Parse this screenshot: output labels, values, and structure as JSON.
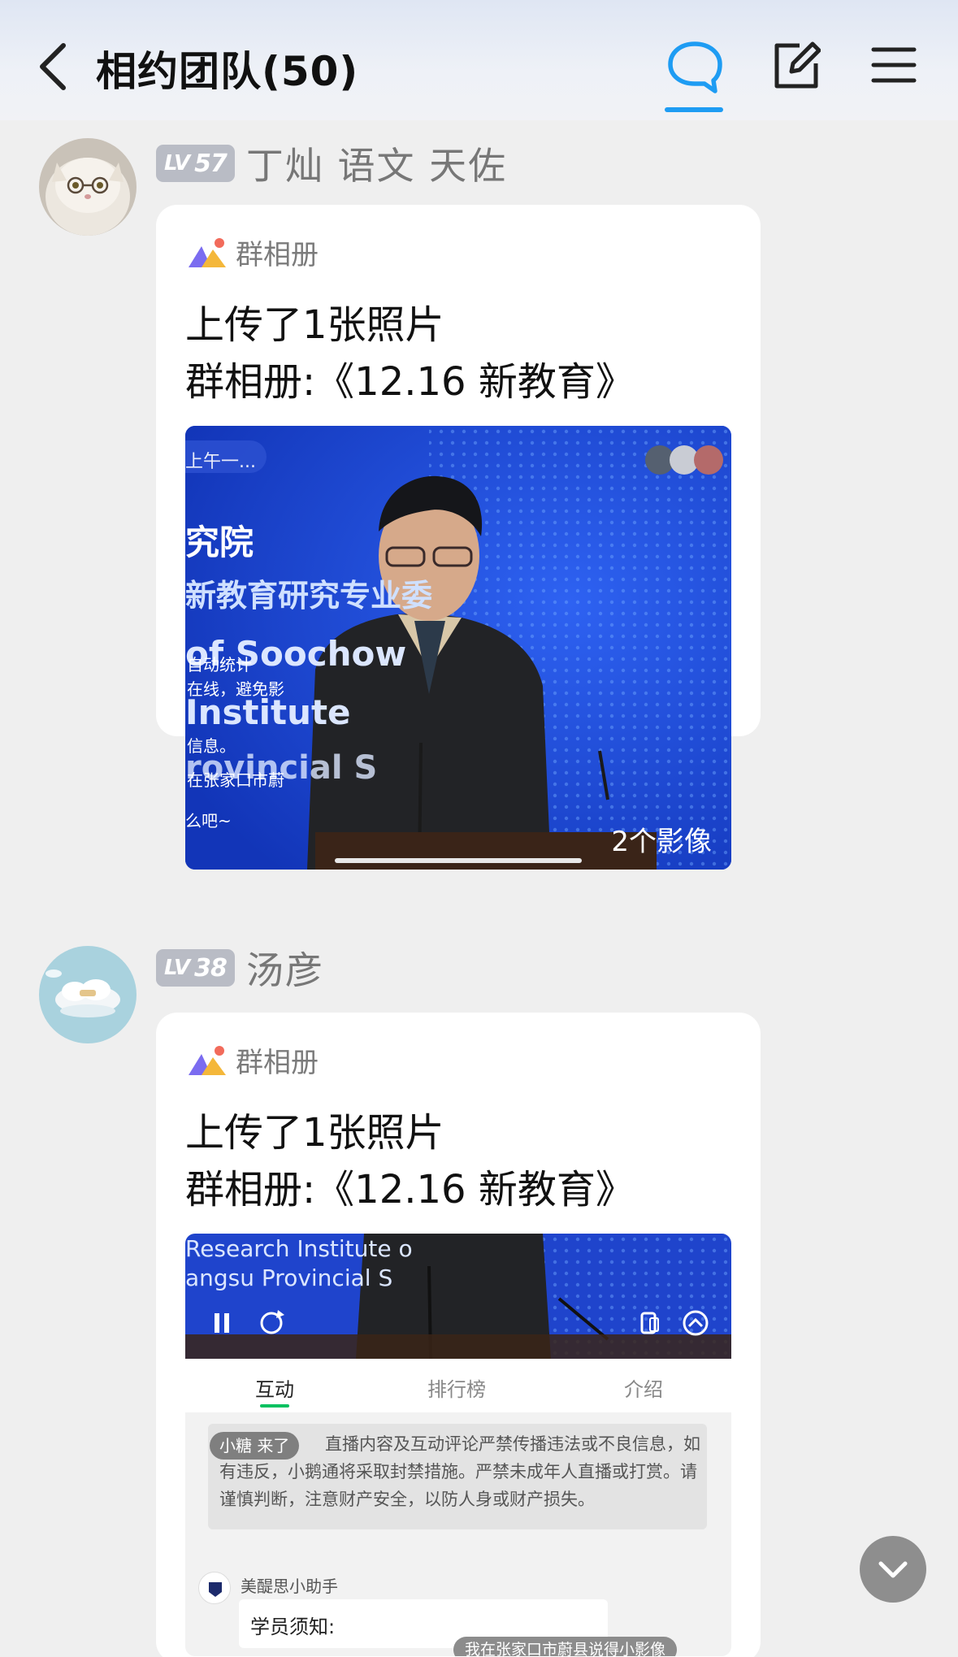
{
  "header": {
    "title": "相约团队(50)",
    "accent_color": "#1e9cf3",
    "icons": [
      "back-arrow-icon",
      "chat-bubble-icon",
      "edit-icon",
      "menu-icon"
    ]
  },
  "messages": [
    {
      "level": "57",
      "level_prefix": "LV",
      "sender": "丁灿 语文 天佐",
      "card": {
        "source": "群相册",
        "line1": "上传了1张照片",
        "line2": "群相册:《12.16 新教育》",
        "photo_overlay": {
          "top_left": "上午一...",
          "big_text": "究院",
          "banner": "新教育研究专业委",
          "english1": "of Soochow",
          "notice_a": "自动统计",
          "notice_b": "在线，避免影",
          "english2": "Institute",
          "notice_c": "信息。",
          "english3": "rovincial S",
          "location": "在张家口市蔚",
          "bottom_left": "么吧~",
          "count_label": "2个影像"
        }
      }
    },
    {
      "level": "38",
      "level_prefix": "LV",
      "sender": "汤彦",
      "card": {
        "source": "群相册",
        "line1": "上传了1张照片",
        "line2": "群相册:《12.16 新教育》",
        "photo_overlay": {
          "english1": "Research Institute o",
          "english2": "angsu Provincial S",
          "tabs": [
            "互动",
            "排行榜",
            "介绍"
          ],
          "active_tab": "互动",
          "tab_accent": "#07c160",
          "notice_tag": "小糖 来了",
          "notice_text": "直播内容及互动评论严禁传播违法或不良信息，如有违反，小鹅通将采取封禁措施。严禁未成年人直播或打赏。请谨慎判断，注意财产安全，以防人身或财产损失。",
          "assistant_name": "美醍思小助手",
          "assistant_msg": "学员须知:",
          "floating_text": "我在张家口市蔚县说得小影像"
        }
      }
    }
  ]
}
